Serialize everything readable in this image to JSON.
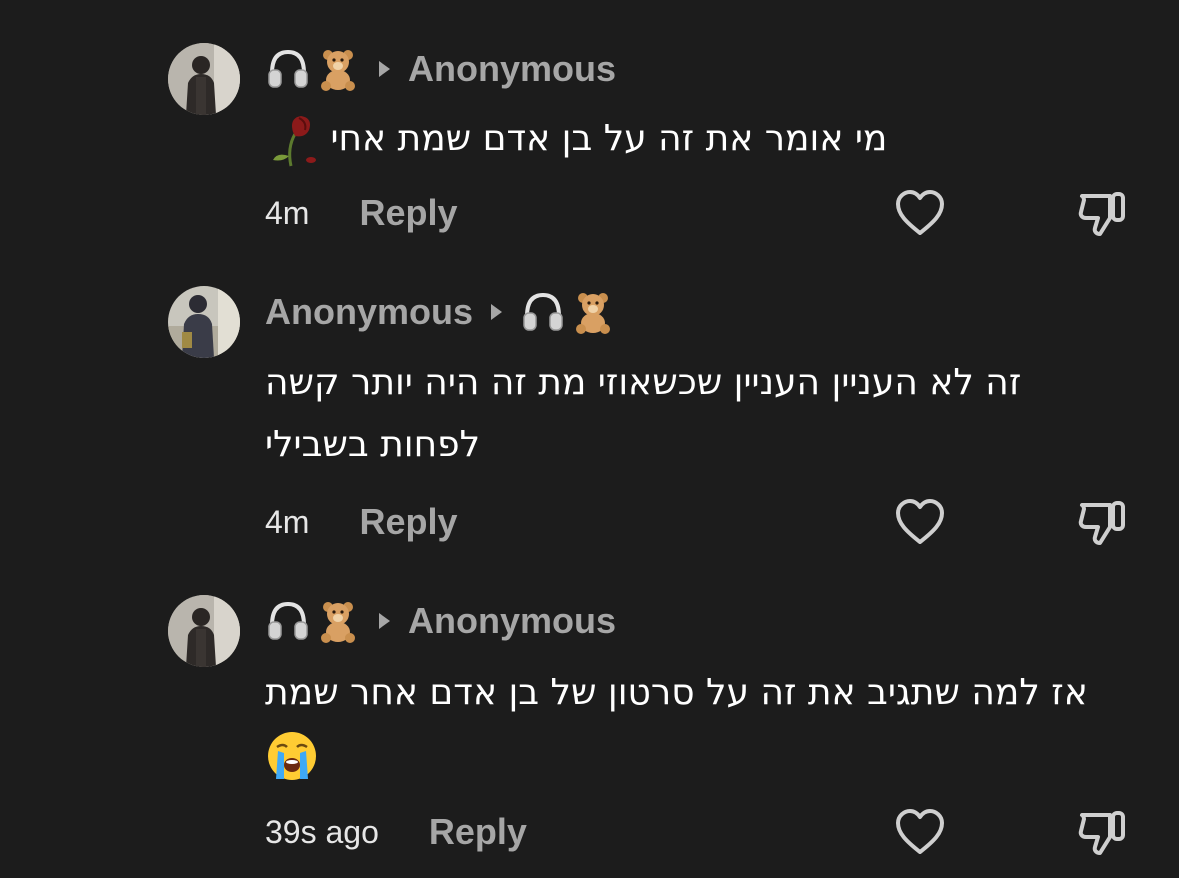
{
  "colors": {
    "background": "#1c1c1c",
    "username": "#a6a6a6",
    "body_text": "#ffffff",
    "icon": "#cfcfcf"
  },
  "comments": [
    {
      "username": "Anonymous",
      "reply_to_icons": [
        "headphones-icon",
        "teddy-bear-icon"
      ],
      "icons_before_name": true,
      "text": "מי אומר את זה על בן אדם שמת אחי",
      "trailing_emoji": "wilted-rose-icon",
      "time": "4m",
      "reply_label": "Reply"
    },
    {
      "username": "Anonymous",
      "reply_to_icons": [
        "headphones-icon",
        "teddy-bear-icon"
      ],
      "icons_before_name": false,
      "text": "זה לא העניין העניין שכשאוזי מת זה היה יותר קשה לפחות בשבילי",
      "trailing_emoji": "",
      "time": "4m",
      "reply_label": "Reply"
    },
    {
      "username": "Anonymous",
      "reply_to_icons": [
        "headphones-icon",
        "teddy-bear-icon"
      ],
      "icons_before_name": true,
      "text": "אז למה שתגיב את זה על סרטון של בן אדם אחר שמת",
      "trailing_emoji": "loudly-crying-face-icon",
      "time": "39s ago",
      "reply_label": "Reply"
    }
  ]
}
